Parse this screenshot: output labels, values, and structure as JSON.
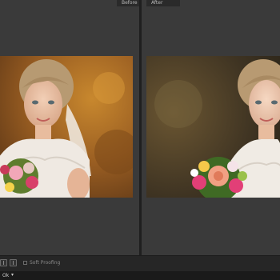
{
  "compare": {
    "before_label": "Before",
    "after_label": "After"
  },
  "toolbar": {
    "soft_proofing_label": "Soft Proofing"
  },
  "bottom": {
    "zoom_text": "Ok",
    "zoom_icon": "chevron-down-icon"
  },
  "colors": {
    "pane_background": "#3a3a3a",
    "toolbar_background": "#262626",
    "label_text": "#bbbbbb"
  }
}
